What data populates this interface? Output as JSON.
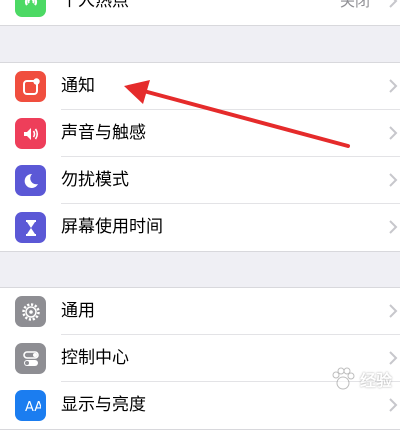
{
  "top_group": {
    "items": [
      {
        "label": "个人热点",
        "value": "关闭",
        "icon": "hotspot-icon",
        "color": "#4cd964"
      }
    ]
  },
  "group1": {
    "items": [
      {
        "label": "通知",
        "icon": "notification-icon",
        "color": "#f04e3e"
      },
      {
        "label": "声音与触感",
        "icon": "speaker-icon",
        "color": "#ee3e5a"
      },
      {
        "label": "勿扰模式",
        "icon": "moon-icon",
        "color": "#5b58d6"
      },
      {
        "label": "屏幕使用时间",
        "icon": "hourglass-icon",
        "color": "#5b58d6"
      }
    ]
  },
  "group2": {
    "items": [
      {
        "label": "通用",
        "icon": "gear-icon",
        "color": "#8e8e93"
      },
      {
        "label": "控制中心",
        "icon": "toggles-icon",
        "color": "#8e8e93"
      },
      {
        "label": "显示与亮度",
        "icon": "display-icon",
        "color": "#1b7df0"
      }
    ]
  },
  "annotation": {
    "color": "#e52b2b"
  },
  "watermark": {
    "text": "经验"
  }
}
